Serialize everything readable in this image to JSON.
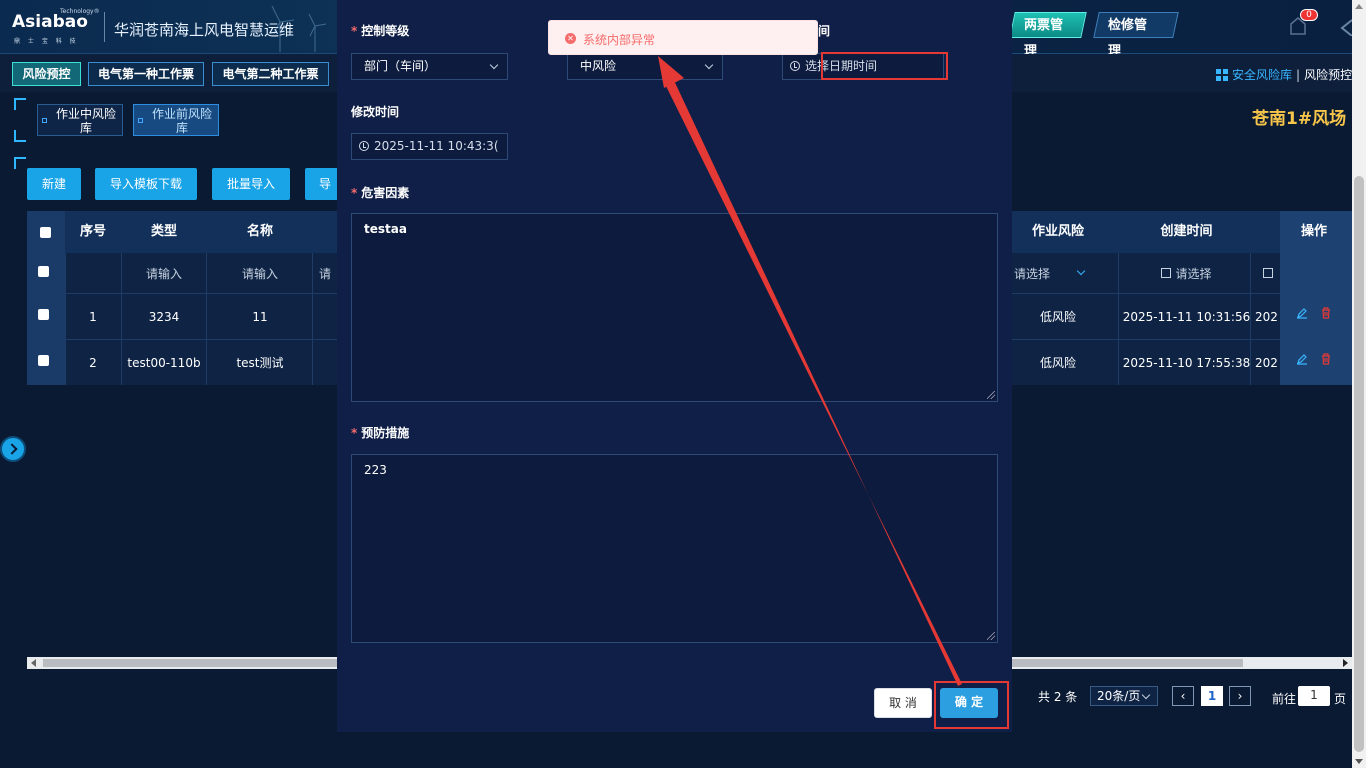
{
  "header": {
    "logo_brand": "Asiabao",
    "logo_tm": "Technology®",
    "logo_sub": "鼎 士 宝 科 技",
    "title": "华润苍南海上风电智慧运维",
    "nav": [
      "两票管理",
      "检修管理"
    ],
    "notification_count": "0"
  },
  "menu": {
    "tabs": [
      "风险预控",
      "电气第一种工作票",
      "电气第二种工作票"
    ]
  },
  "breadcrumb": {
    "items": [
      "安全风险库",
      "风险预控"
    ]
  },
  "sub_tabs": [
    "作业中风险库",
    "作业前风险库"
  ],
  "farm_name": "苍南1#风场",
  "toolbar": {
    "buttons": [
      "新建",
      "导入模板下载",
      "批量导入",
      "导"
    ]
  },
  "table": {
    "headers": {
      "index": "序号",
      "type": "类型",
      "name": "名称",
      "risk": "作业风险",
      "created": "创建时间",
      "ops": "操作"
    },
    "filter_placeholders": {
      "type": "请输入",
      "name": "请输入",
      "third": "请",
      "risk": "请选择",
      "created": "请选择"
    },
    "rows": [
      {
        "index": "1",
        "type": "3234",
        "name": "11",
        "risk": "低风险",
        "created": "2025-11-11 10:31:56",
        "modified": "202"
      },
      {
        "index": "2",
        "type": "test00-110b",
        "name": "test测试",
        "risk": "低风险",
        "created": "2025-11-10 17:55:38",
        "modified": "202"
      }
    ]
  },
  "pagination": {
    "total": "共 2 条",
    "page_size": "20条/页",
    "current_page": "1",
    "goto_label": "前往",
    "goto_value": "1",
    "page_suffix": "页"
  },
  "modal": {
    "control_level_label": "控制等级",
    "control_level_value": "部门（车间）",
    "risk_level_value": "中风险",
    "time_label_fragment": "间",
    "time_placeholder": "选择日期时间",
    "modified_time_label": "修改时间",
    "modified_time_value": "2025-11-11 10:43:3(",
    "hazard_label": "危害因素",
    "hazard_value": "testaa",
    "prevention_label": "预防措施",
    "prevention_value": "223",
    "cancel_label": "取 消",
    "confirm_label": "确 定"
  },
  "toast": {
    "message": "系统内部异常"
  },
  "colors": {
    "accent": "#1aa4e8",
    "error": "#f56c6c",
    "annotation": "#e53935",
    "farm_name": "#f6c54a"
  }
}
